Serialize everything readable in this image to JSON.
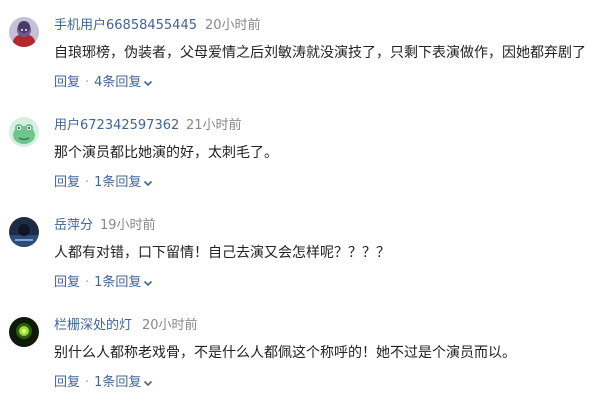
{
  "comments": [
    {
      "username": "手机用户66858455445",
      "time": "20小时前",
      "content": "自琅琊榜，伪装者，父母爱情之后刘敏涛就没演技了，只剩下表演做作，因她都弃剧了",
      "reply_label": "回复",
      "replies_label": "4条回复",
      "avatar_icon": "avatar-purple-face-icon"
    },
    {
      "username": "用户672342597362",
      "time": "21小时前",
      "content": "那个演员都比她演的好，太刺毛了。",
      "reply_label": "回复",
      "replies_label": "1条回复",
      "avatar_icon": "avatar-green-frog-icon"
    },
    {
      "username": "岳萍分",
      "time": "19小时前",
      "content": "人都有对错，口下留情！自己去演又会怎样呢？？？？",
      "reply_label": "回复",
      "replies_label": "1条回复",
      "avatar_icon": "avatar-dark-photo-icon"
    },
    {
      "username": "栏栅深处的灯",
      "time": "20小时前",
      "content": "别什么人都称老戏骨，不是什么人都佩这个称呼的！她不过是个演员而以。",
      "reply_label": "回复",
      "replies_label": "1条回复",
      "avatar_icon": "avatar-green-light-icon"
    }
  ],
  "separator": "·",
  "colors": {
    "link": "#406599",
    "timestamp": "#888888",
    "text": "#222222"
  }
}
